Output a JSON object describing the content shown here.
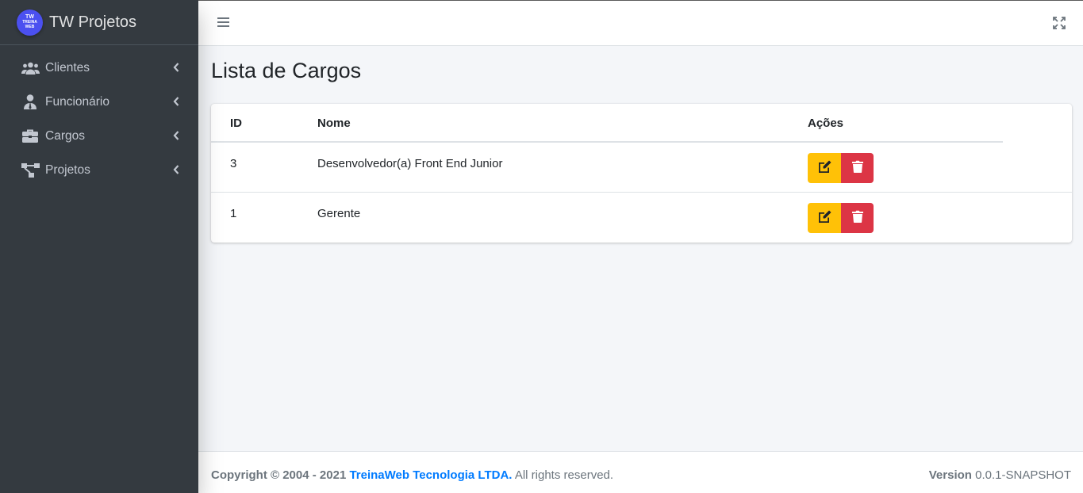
{
  "brand": {
    "title": "TW Projetos",
    "logo_line1": "TW",
    "logo_line2": "TREINA",
    "logo_line3": "WEB",
    "logo_color": "#4b50f0"
  },
  "sidebar": {
    "items": [
      {
        "label": "Clientes",
        "icon": "users-icon"
      },
      {
        "label": "Funcionário",
        "icon": "user-tie-icon"
      },
      {
        "label": "Cargos",
        "icon": "briefcase-icon"
      },
      {
        "label": "Projetos",
        "icon": "project-diagram-icon"
      }
    ]
  },
  "page": {
    "title": "Lista de Cargos"
  },
  "table": {
    "headers": {
      "id": "ID",
      "name": "Nome",
      "actions": "Ações"
    },
    "rows": [
      {
        "id": "3",
        "name": "Desenvolvedor(a) Front End Junior"
      },
      {
        "id": "1",
        "name": "Gerente"
      }
    ]
  },
  "footer": {
    "copyright": "Copyright © 2004 - 2021",
    "company": "TreinaWeb Tecnologia LTDA.",
    "rights": "All rights reserved.",
    "version_label": "Version",
    "version_value": "0.0.1-SNAPSHOT"
  },
  "colors": {
    "sidebar": "#343a40",
    "edit": "#ffc107",
    "delete": "#dc3545",
    "link": "#007bff"
  }
}
